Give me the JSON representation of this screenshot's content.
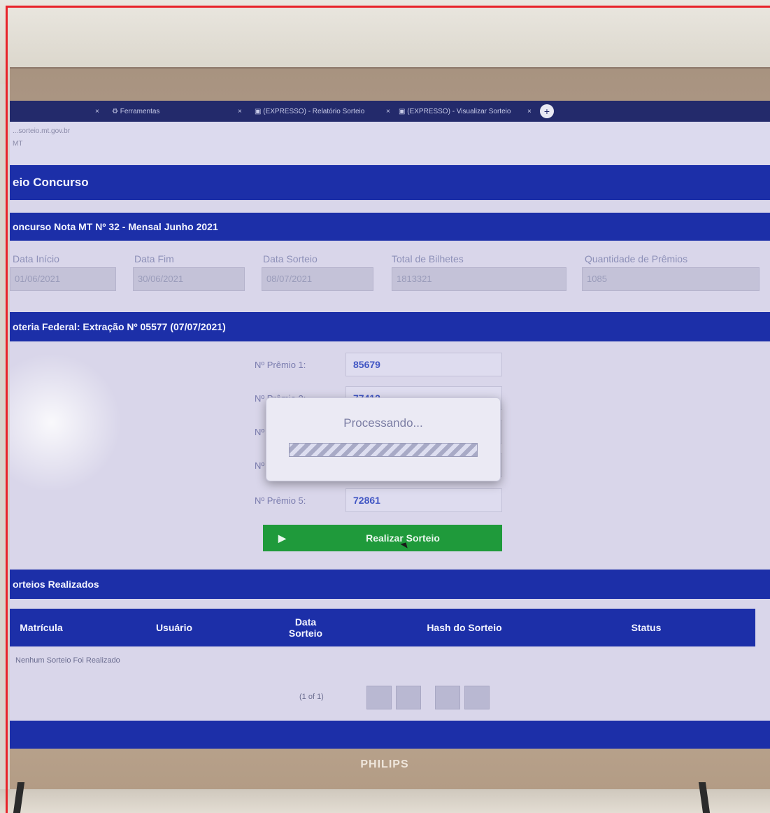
{
  "browser": {
    "tabs": [
      {
        "label": "×",
        "close": ""
      },
      {
        "label": "Ferramentas",
        "close": "×"
      },
      {
        "label": "(EXPRESSO) - Relatório Sorteio",
        "close": "×"
      },
      {
        "label": "(EXPRESSO) - Visualizar Sorteio",
        "close": "×"
      }
    ],
    "new_tab": "+",
    "address_line1": "...sorteio.mt.gov.br",
    "address_line2": "MT"
  },
  "page": {
    "title": "eio Concurso"
  },
  "contest": {
    "heading": "oncurso Nota MT Nº 32 - Mensal Junho 2021",
    "fields": [
      {
        "label": "Data Início",
        "value": "01/06/2021"
      },
      {
        "label": "Data Fim",
        "value": "30/06/2021"
      },
      {
        "label": "Data Sorteio",
        "value": "08/07/2021"
      },
      {
        "label": "Total de Bilhetes",
        "value": "1813321"
      },
      {
        "label": "Quantidade de Prêmios",
        "value": "1085"
      }
    ]
  },
  "lottery": {
    "heading": "oteria Federal: Extração Nº 05577 (07/07/2021)",
    "prizes": [
      {
        "label": "Nº Prêmio 1:",
        "value": "85679"
      },
      {
        "label": "Nº Prêmio 2:",
        "value": "77412"
      },
      {
        "label": "Nº",
        "value": ""
      },
      {
        "label": "Nº",
        "value": ""
      },
      {
        "label": "Nº Prêmio 5:",
        "value": "72861"
      }
    ],
    "run_button": {
      "icon": "▶",
      "label": "Realizar Sorteio"
    }
  },
  "modal": {
    "title": "Processando...",
    "progress": 1.0
  },
  "history": {
    "heading": "orteios Realizados",
    "columns": [
      "Matrícula",
      "Usuário",
      "Data Sorteio",
      "Hash do Sorteio",
      "Status"
    ],
    "empty_message": "Nenhum Sorteio Foi Realizado",
    "pager_text": "(1 of 1)"
  },
  "monitor": {
    "brand": "PHILIPS"
  },
  "colors": {
    "accent": "#1c2fa8",
    "button": "#1f9a3b",
    "frame": "#e8232a"
  }
}
